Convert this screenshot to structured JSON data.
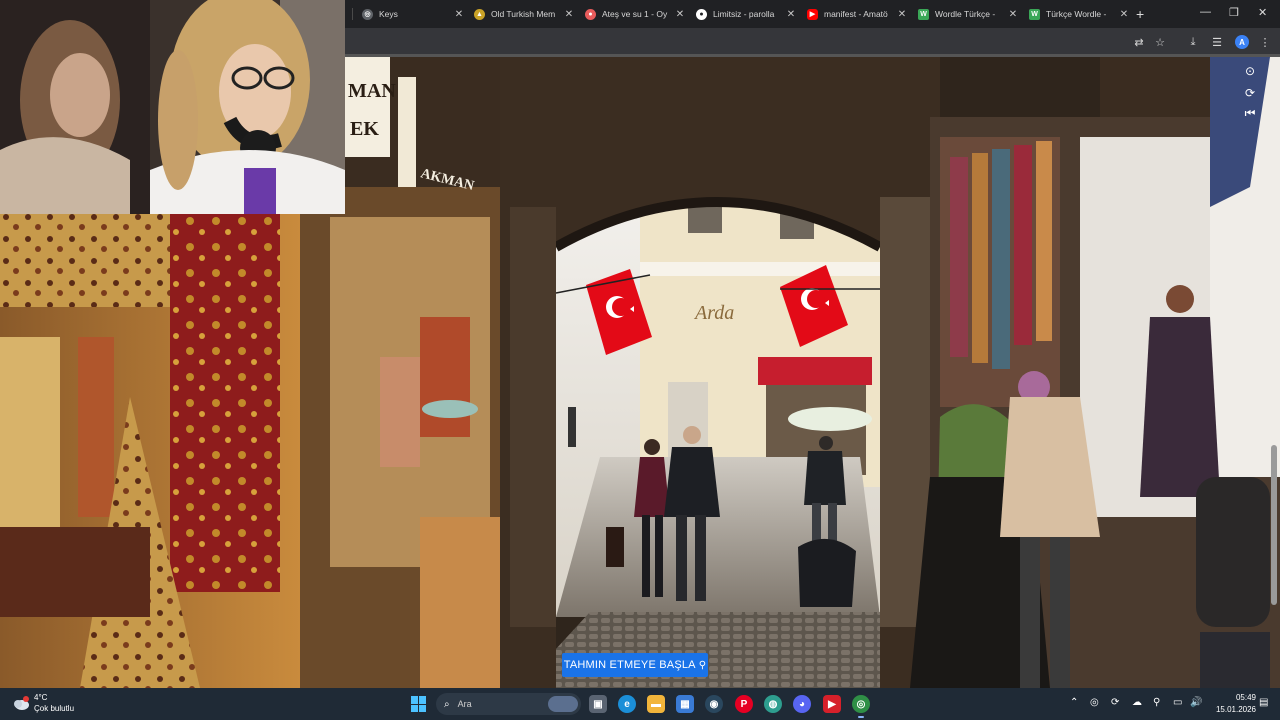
{
  "browser": {
    "tabs": [
      {
        "title": "Keys",
        "favicon": "globe-icon",
        "color": "#9aa0a6",
        "glyph": "◎"
      },
      {
        "title": "Old Turkish Mem",
        "favicon": "site-icon",
        "color": "#c9a227",
        "glyph": "▲"
      },
      {
        "title": "Ateş ve su 1 - Oy",
        "favicon": "game-icon",
        "color": "#e85c5c",
        "glyph": "●"
      },
      {
        "title": "Limitsiz - parolla",
        "favicon": "site-icon",
        "color": "#ffffff",
        "glyph": "●"
      },
      {
        "title": "manifest - Amatö",
        "favicon": "youtube-icon",
        "color": "#ff0000",
        "glyph": "▶"
      },
      {
        "title": "Wordle Türkçe - ",
        "favicon": "wordle-icon",
        "color": "#3aa757",
        "glyph": "W"
      },
      {
        "title": "Türkçe Wordle - ",
        "favicon": "wordle-icon",
        "color": "#3aa757",
        "glyph": "W"
      }
    ],
    "new_tab_label": "+",
    "window_controls": {
      "minimize": "—",
      "restore": "❐",
      "close": "✕"
    },
    "toolbar_icons": {
      "translate": "⇄",
      "bookmark": "☆",
      "download": "⤓",
      "reading_list": "☰",
      "menu": "⋮"
    },
    "profile_initial": "A"
  },
  "game": {
    "guess_button_label": "TAHMIN ETMEYE BAŞLA",
    "pin_glyph": "⚲",
    "controls": {
      "compass": "⊙",
      "reset": "⟳",
      "back": "⏮"
    },
    "scene_signs": {
      "shop_sign_1": "MAN",
      "shop_sign_2": "EK",
      "shop_sign_3": "AKMAN",
      "storefront_sign": "Arda"
    }
  },
  "taskbar": {
    "weather_temp": "4°C",
    "weather_desc": "Çok bulutlu",
    "search_placeholder": "Ara",
    "search_glyph": "⌕",
    "clock_time": "05:49",
    "clock_date": "15.01.2026",
    "apps": [
      {
        "name": "task-view",
        "glyph": "▣",
        "color": "#5a6472"
      },
      {
        "name": "edge",
        "glyph": "e",
        "color": "#1b8fd8"
      },
      {
        "name": "file-explorer",
        "glyph": "▬",
        "color": "#f2b53b"
      },
      {
        "name": "store",
        "glyph": "▦",
        "color": "#3a7bd5"
      },
      {
        "name": "steam",
        "glyph": "◉",
        "color": "#2a475e"
      },
      {
        "name": "pinterest",
        "glyph": "P",
        "color": "#e60023"
      },
      {
        "name": "browser-alt",
        "glyph": "◍",
        "color": "#2e9e8f"
      },
      {
        "name": "discord",
        "glyph": "◕",
        "color": "#5865f2"
      },
      {
        "name": "media-app",
        "glyph": "▶",
        "color": "#d6202a"
      },
      {
        "name": "chrome",
        "glyph": "◎",
        "color": "#2f8f46"
      }
    ],
    "tray_glyphs": {
      "overflow": "⌃",
      "location": "◎",
      "sync": "⟳",
      "cloud": "☁",
      "bluetooth": "⚲",
      "mic": "🎙",
      "network": "▭",
      "volume": "🔊",
      "notifications": "▤"
    }
  },
  "colors": {
    "accent": "#1a73e8",
    "tab_bg": "#202124",
    "toolbar_bg": "#35363a",
    "taskbar_bg": "#1f2a36",
    "flag_red": "#e30a17"
  }
}
